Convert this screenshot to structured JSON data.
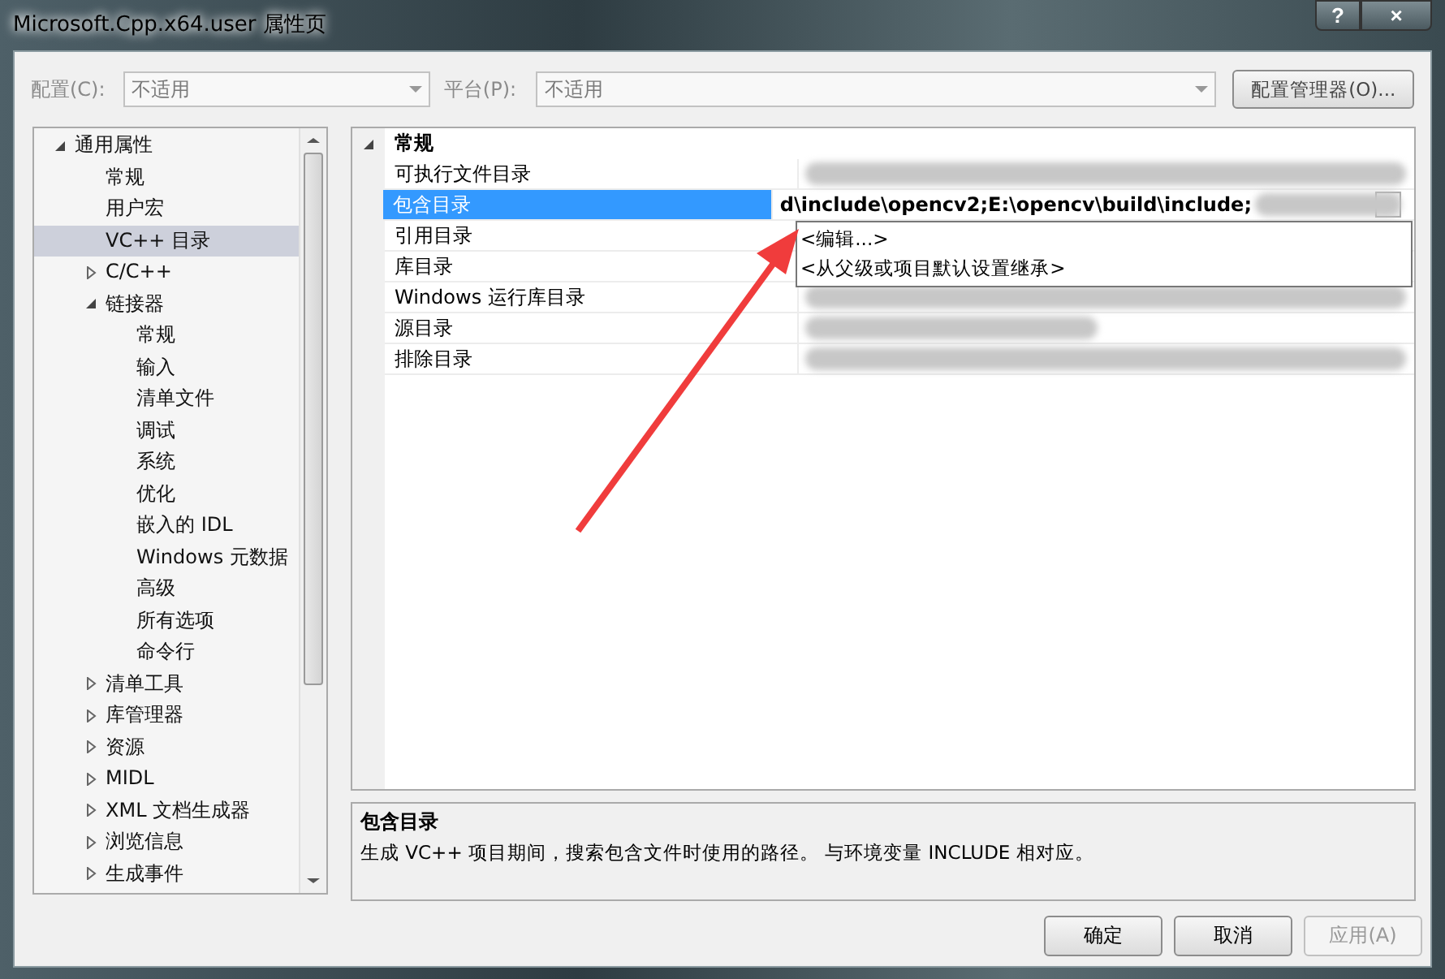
{
  "window": {
    "title": "Microsoft.Cpp.x64.user 属性页",
    "buttons": [
      {
        "kind": "help",
        "label": "?"
      },
      {
        "kind": "close",
        "label": "×"
      }
    ]
  },
  "toolbar": {
    "configuration": {
      "label": "配置(C):",
      "value": "不适用",
      "disabled": true
    },
    "platform": {
      "label": "平台(P):",
      "value": "不适用",
      "disabled": true
    },
    "manager_button": "配置管理器(O)..."
  },
  "tree": [
    {
      "label": "通用属性",
      "expanded": true,
      "selected": false,
      "children": [
        {
          "label": "常规",
          "selected": false
        },
        {
          "label": "用户宏",
          "selected": false
        },
        {
          "label": "VC++ 目录",
          "selected": true
        },
        {
          "label": "C/C++",
          "expanded": false,
          "selected": false
        },
        {
          "label": "链接器",
          "expanded": true,
          "selected": false,
          "children": [
            {
              "label": "常规",
              "selected": false
            },
            {
              "label": "输入",
              "selected": false
            },
            {
              "label": "清单文件",
              "selected": false
            },
            {
              "label": "调试",
              "selected": false
            },
            {
              "label": "系统",
              "selected": false
            },
            {
              "label": "优化",
              "selected": false
            },
            {
              "label": "嵌入的 IDL",
              "selected": false
            },
            {
              "label": "Windows 元数据",
              "selected": false
            },
            {
              "label": "高级",
              "selected": false
            },
            {
              "label": "所有选项",
              "selected": false
            },
            {
              "label": "命令行",
              "selected": false
            }
          ]
        },
        {
          "label": "清单工具",
          "expanded": false,
          "selected": false
        },
        {
          "label": "库管理器",
          "expanded": false,
          "selected": false
        },
        {
          "label": "资源",
          "expanded": false,
          "selected": false
        },
        {
          "label": "MIDL",
          "expanded": false,
          "selected": false
        },
        {
          "label": "XML 文档生成器",
          "expanded": false,
          "selected": false
        },
        {
          "label": "浏览信息",
          "expanded": false,
          "selected": false
        },
        {
          "label": "生成事件",
          "expanded": false,
          "selected": false
        }
      ]
    }
  ],
  "property_grid": {
    "category": {
      "label": "常规",
      "expanded": true
    },
    "rows": [
      {
        "name": "可执行文件目录",
        "selected": false,
        "redacted": true
      },
      {
        "name": "包含目录",
        "selected": true,
        "value": "d\\include\\opencv2;E:\\opencv\\build\\include;",
        "redacted": true
      },
      {
        "name": "引用目录",
        "selected": false,
        "redacted": false
      },
      {
        "name": "库目录",
        "selected": false,
        "redacted": false
      },
      {
        "name": "Windows 运行库目录",
        "selected": false,
        "redacted": true
      },
      {
        "name": "源目录",
        "selected": false,
        "redacted": true
      },
      {
        "name": "排除目录",
        "selected": false,
        "redacted": true
      }
    ],
    "dropdown_options": [
      "<编辑...>",
      "<从父级或项目默认设置继承>"
    ]
  },
  "description": {
    "title": "包含目录",
    "text": "生成 VC++ 项目期间，搜索包含文件时使用的路径。  与环境变量 INCLUDE 相对应。"
  },
  "buttons": [
    {
      "label": "确定",
      "disabled": false
    },
    {
      "label": "取消",
      "disabled": false
    },
    {
      "label": "应用(A)",
      "disabled": true
    }
  ],
  "annotation_arrow": true
}
